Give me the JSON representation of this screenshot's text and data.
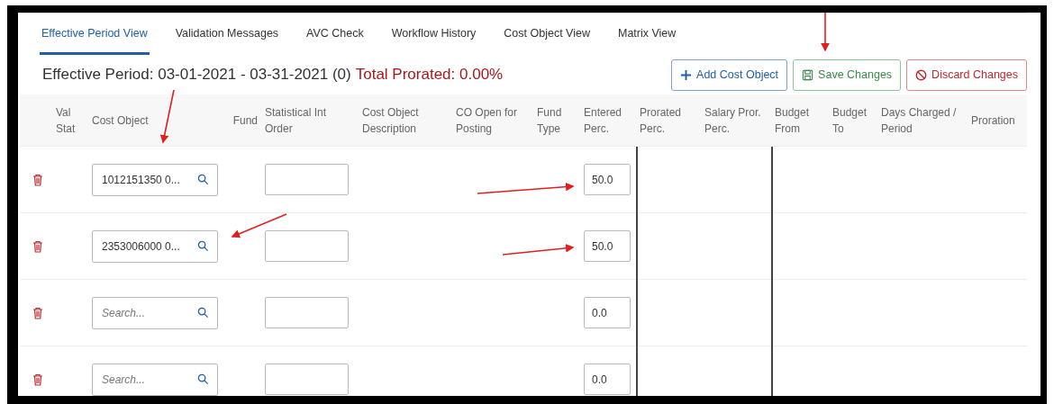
{
  "tabs": [
    {
      "label": "Effective Period View",
      "selected": true
    },
    {
      "label": "Validation Messages",
      "selected": false
    },
    {
      "label": "AVC Check",
      "selected": false
    },
    {
      "label": "Workflow History",
      "selected": false
    },
    {
      "label": "Cost Object View",
      "selected": false
    },
    {
      "label": "Matrix View",
      "selected": false
    }
  ],
  "period": {
    "label": "Effective Period: 03-01-2021 - 03-31-2021 (0)",
    "total_prorated": "Total Prorated: 0.00%"
  },
  "buttons": [
    {
      "kind": "add",
      "label": "Add Cost Object"
    },
    {
      "kind": "save",
      "label": "Save Changes"
    },
    {
      "kind": "discard",
      "label": "Discard Changes"
    }
  ],
  "columns": [
    "",
    "Val Stat",
    "Cost Object",
    "Fund",
    "Statistical Int Order",
    "Cost Object Description",
    "CO Open for Posting",
    "Fund Type",
    "Entered Perc.",
    "Prorated Perc.",
    "Salary Pror. Perc.",
    "Budget From",
    "Budget To",
    "Days Charged / Period",
    "Proration"
  ],
  "rows": [
    {
      "cost_object": {
        "value": "1012151350 0..."
      },
      "entered_perc": "50.0"
    },
    {
      "cost_object": {
        "value": "2353006000 0..."
      },
      "entered_perc": "50.0"
    },
    {
      "cost_object": {
        "placeholder": "Search..."
      },
      "entered_perc": "0.0"
    },
    {
      "cost_object": {
        "placeholder": "Search..."
      },
      "entered_perc": "0.0"
    }
  ]
}
